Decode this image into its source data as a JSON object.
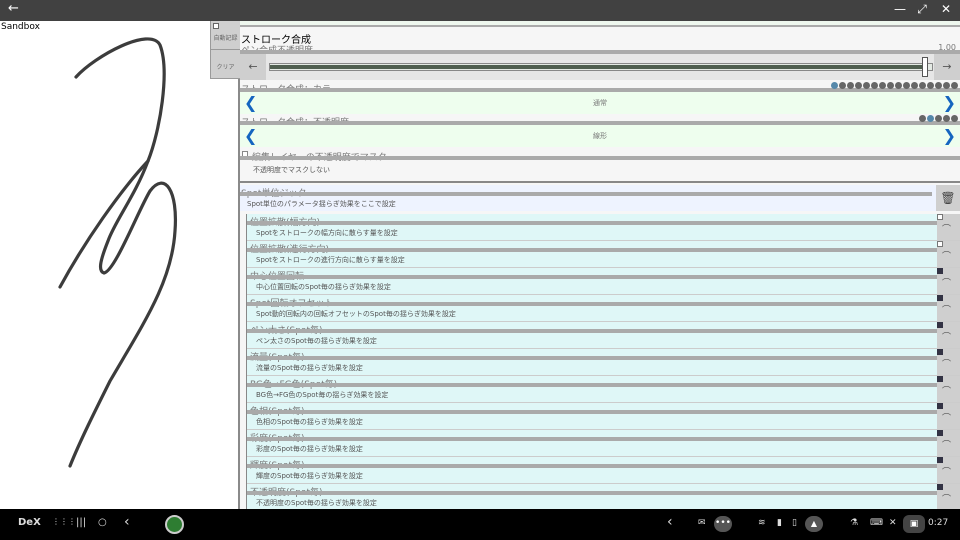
{
  "window": {
    "back_label": "←",
    "maximize_label": "⤢",
    "close_label": "✕"
  },
  "canvas": {
    "sandbox_label": "Sandbox",
    "overlay_top_label": "自動記録",
    "overlay_clear_label": "クリア"
  },
  "panel": {
    "section_title": "ストローク合成",
    "pen_opacity": {
      "label": "ペン合成不透明度",
      "value_text": "1.00",
      "value": 1.0,
      "left_arrow": "←",
      "right_arrow": "→"
    },
    "color_blend": {
      "label": "ストローク合成：カラー",
      "value": "通常",
      "left": "❮",
      "right": "❯"
    },
    "opacity_blend": {
      "label": "ストローク合成：不透明度",
      "value": "線形",
      "left": "❮",
      "right": "❯"
    },
    "mask": {
      "label": "編集レイヤーの不透明度でマスク",
      "sub": "不透明度でマスクしない"
    },
    "jitter": {
      "title": "Spot単位ジッター",
      "desc": "Spot単位のパラメータ揺らぎ効果をここで設定",
      "trash_icon": "🗑"
    },
    "items": [
      {
        "title": "位置拡散(幅方向)",
        "desc": "Spotをストロークの幅方向に散らす量を設定"
      },
      {
        "title": "位置拡散(進行方向)",
        "desc": "Spotをストロークの進行方向に散らす量を設定"
      },
      {
        "title": "中心位置回転",
        "desc": "中心位置回転のSpot毎の揺らぎ効果を設定"
      },
      {
        "title": "Spot回転オフセット",
        "desc": "Spot動的回転内の回転オフセットのSpot毎の揺らぎ効果を設定"
      },
      {
        "title": "ペン太さ(Spot毎)",
        "desc": "ペン太さのSpot毎の揺らぎ効果を設定"
      },
      {
        "title": "流量(Spot毎)",
        "desc": "流量のSpot毎の揺らぎ効果を設定"
      },
      {
        "title": "BG色→FG色(Spot毎)",
        "desc": "BG色→FG色のSpot毎の揺らぎ効果を設定"
      },
      {
        "title": "色相(Spot毎)",
        "desc": "色相のSpot毎の揺らぎ効果を設定"
      },
      {
        "title": "彩度(Spot毎)",
        "desc": "彩度のSpot毎の揺らぎ効果を設定"
      },
      {
        "title": "輝度(Spot毎)",
        "desc": "輝度のSpot毎の揺らぎ効果を設定"
      },
      {
        "title": "不透明度(Spot毎)",
        "desc": "不透明度のSpot毎の揺らぎ効果を設定"
      }
    ]
  },
  "taskbar": {
    "dex_label": "DeX",
    "apps_icon": "⋮⋮⋮",
    "recents_icon": "|||",
    "home_icon": "○",
    "back_icon": "‹",
    "collapse_icon": "‹",
    "time": "0:27"
  }
}
